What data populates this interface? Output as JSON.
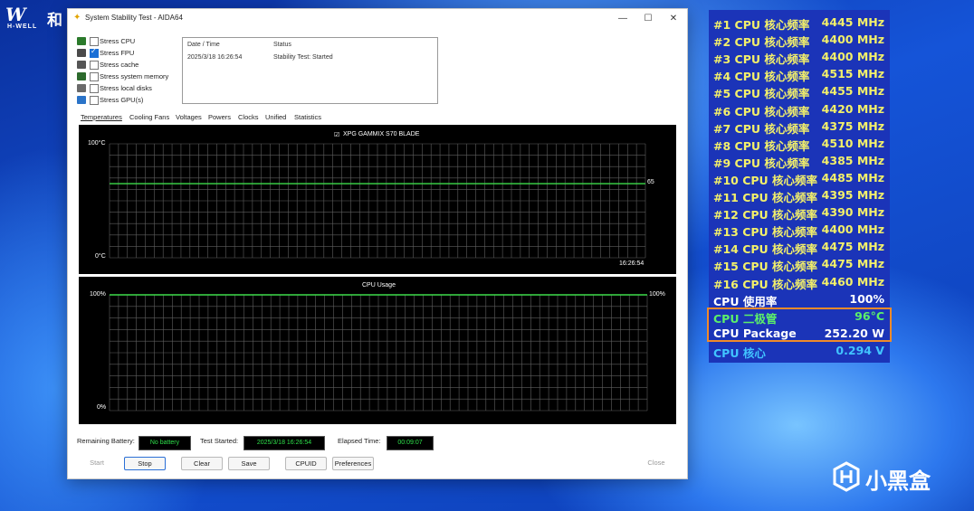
{
  "brand": {
    "top_left_mark": "W",
    "top_left_cn": "和",
    "top_left_sub": "H-WELL",
    "bottom_right": "小黑盒"
  },
  "window": {
    "title": "System Stability Test - AIDA64",
    "minimize_glyph": "—",
    "maximize_glyph": "☐",
    "close_glyph": "✕"
  },
  "stress_options": [
    {
      "label": "Stress CPU",
      "checked": false,
      "icon": "cpu-icon"
    },
    {
      "label": "Stress FPU",
      "checked": true,
      "icon": "fpu-icon"
    },
    {
      "label": "Stress cache",
      "checked": false,
      "icon": "cache-icon"
    },
    {
      "label": "Stress system memory",
      "checked": false,
      "icon": "memory-icon"
    },
    {
      "label": "Stress local disks",
      "checked": false,
      "icon": "disk-icon"
    },
    {
      "label": "Stress GPU(s)",
      "checked": false,
      "icon": "monitor-icon"
    }
  ],
  "status_table": {
    "headers": [
      "Date / Time",
      "Status"
    ],
    "rows": [
      [
        "2025/3/18 16:26:54",
        "Stability Test: Started"
      ]
    ]
  },
  "tabs": [
    "Temperatures",
    "Cooling Fans",
    "Voltages",
    "Powers",
    "Clocks",
    "Unified",
    "Statistics"
  ],
  "temp_graph": {
    "legend": "XPG GAMMIX S70 BLADE",
    "legend_checked": true,
    "y_top": "100°C",
    "y_bottom": "0°C",
    "x_time": "16:26:54",
    "value_label": "65",
    "value": 65,
    "range": [
      0,
      100
    ]
  },
  "usage_graph": {
    "title": "CPU Usage",
    "y_top": "100%",
    "y_bottom": "0%",
    "value_label": "100%",
    "value": 100,
    "range": [
      0,
      100
    ]
  },
  "bottom": {
    "battery_label": "Remaining Battery:",
    "battery_value": "No battery",
    "started_label": "Test Started:",
    "started_value": "2025/3/18 16:26:54",
    "elapsed_label": "Elapsed Time:",
    "elapsed_value": "00:09:07"
  },
  "buttons": {
    "start": "Start",
    "stop": "Stop",
    "clear": "Clear",
    "save": "Save",
    "cpuid": "CPUID",
    "preferences": "Preferences",
    "close": "Close"
  },
  "osd": {
    "rows": [
      {
        "label": "#1 CPU 核心频率",
        "value": "4445 MHz",
        "color": "#f3f06a"
      },
      {
        "label": "#2 CPU 核心频率",
        "value": "4400 MHz",
        "color": "#f3f06a"
      },
      {
        "label": "#3 CPU 核心频率",
        "value": "4400 MHz",
        "color": "#f3f06a"
      },
      {
        "label": "#4 CPU 核心频率",
        "value": "4515 MHz",
        "color": "#f3f06a"
      },
      {
        "label": "#5 CPU 核心频率",
        "value": "4455 MHz",
        "color": "#f3f06a"
      },
      {
        "label": "#6 CPU 核心频率",
        "value": "4420 MHz",
        "color": "#f3f06a"
      },
      {
        "label": "#7 CPU 核心频率",
        "value": "4375 MHz",
        "color": "#f3f06a"
      },
      {
        "label": "#8 CPU 核心频率",
        "value": "4510 MHz",
        "color": "#f3f06a"
      },
      {
        "label": "#9 CPU 核心频率",
        "value": "4385 MHz",
        "color": "#f3f06a"
      },
      {
        "label": "#10 CPU 核心频率",
        "value": "4485 MHz",
        "color": "#f3f06a"
      },
      {
        "label": "#11 CPU 核心频率",
        "value": "4395 MHz",
        "color": "#f3f06a"
      },
      {
        "label": "#12 CPU 核心频率",
        "value": "4390 MHz",
        "color": "#f3f06a"
      },
      {
        "label": "#13 CPU 核心频率",
        "value": "4400 MHz",
        "color": "#f3f06a"
      },
      {
        "label": "#14 CPU 核心频率",
        "value": "4475 MHz",
        "color": "#f3f06a"
      },
      {
        "label": "#15 CPU 核心频率",
        "value": "4475 MHz",
        "color": "#f3f06a"
      },
      {
        "label": "#16 CPU 核心频率",
        "value": "4460 MHz",
        "color": "#f3f06a"
      },
      {
        "label": "CPU 使用率",
        "value": "100%",
        "color": "#ffffff"
      },
      {
        "label": "CPU 二极管",
        "value": "96°C",
        "color": "#5cf06a"
      },
      {
        "label": "CPU Package",
        "value": "252.20 W",
        "color": "#ffffff"
      },
      {
        "label": "CPU 核心",
        "value": "0.294 V",
        "color": "#41c4ff"
      }
    ],
    "highlight_color": "#f08a2a"
  }
}
